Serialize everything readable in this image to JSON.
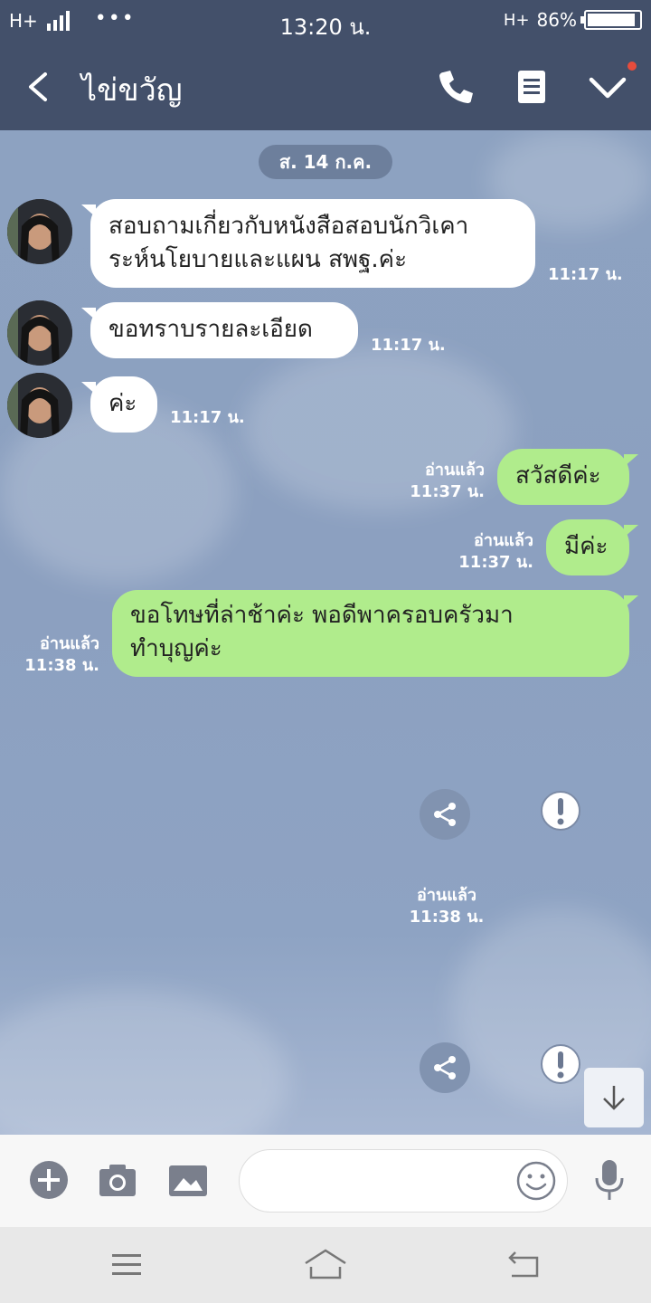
{
  "status_bar": {
    "network": "H+",
    "dots": "•••",
    "time": "13:20 น.",
    "network_right": "H+",
    "battery": "86%",
    "battery_level": 0.86
  },
  "header": {
    "title": "ไข่ขวัญ",
    "icons": [
      "back-arrow",
      "phone",
      "memo",
      "chevron-down"
    ]
  },
  "chat": {
    "date": "ส. 14 ก.ค.",
    "incoming": [
      {
        "lines": [
          "สอบถามเกี่ยวกับหนังสือสอบนักวิเคา",
          "ระห์นโยบายและแผน สพฐ.ค่ะ"
        ],
        "time": "11:17 น."
      },
      {
        "lines": [
          "ขอทราบรายละเอียด"
        ],
        "time": "11:17 น."
      },
      {
        "lines": [
          "ค่ะ"
        ],
        "time": "11:17 น."
      }
    ],
    "outgoing": [
      {
        "lines": [
          "สวัสดีค่ะ"
        ],
        "read": "อ่านแล้ว",
        "time": "11:37 น."
      },
      {
        "lines": [
          "มีค่ะ"
        ],
        "read": "อ่านแล้ว",
        "time": "11:37 น."
      },
      {
        "lines": [
          "ขอโทษที่ล่าช้าค่ะ พอดีพาครอบครัวมา",
          "ทำบุญค่ะ"
        ],
        "read": "อ่านแล้ว",
        "time": "11:38 น."
      }
    ],
    "media_meta": {
      "read": "อ่านแล้ว",
      "time": "11:38 น."
    }
  },
  "input_bar": {
    "placeholder": "",
    "icons": [
      "plus",
      "camera",
      "image",
      "emoji",
      "microphone"
    ]
  },
  "nav_bar": {
    "icons": [
      "menu",
      "home",
      "back"
    ]
  },
  "colors": {
    "header_bg": "#43506a",
    "chat_bg": "#8da2c1",
    "incoming_bubble": "#ffffff",
    "outgoing_bubble": "#b0ec8c"
  }
}
